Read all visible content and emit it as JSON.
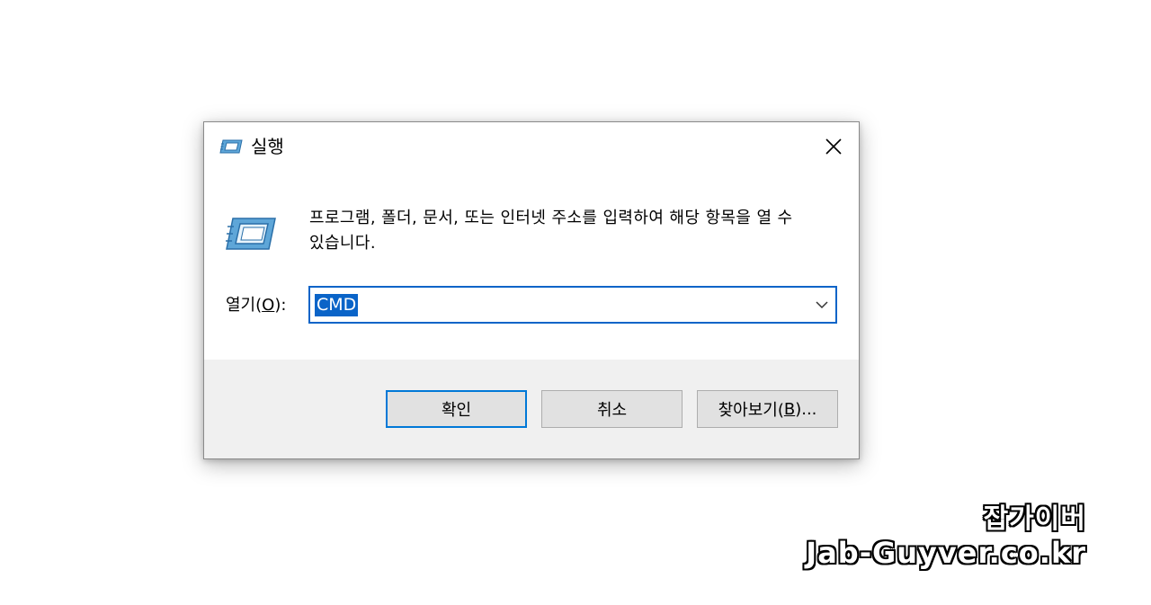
{
  "dialog": {
    "title": "실행",
    "close_icon": "close-icon",
    "description": "프로그램, 폴더, 문서, 또는 인터넷 주소를 입력하여 해당 항목을 열 수 있습니다.",
    "open_label_prefix": "열기(",
    "open_label_accel": "O",
    "open_label_suffix": "):",
    "open_value": "CMD",
    "buttons": {
      "ok": "확인",
      "cancel": "취소",
      "browse_prefix": "찾아보기(",
      "browse_accel": "B",
      "browse_suffix": ")..."
    },
    "accent_color": "#0a64c8"
  },
  "watermark": {
    "line1": "잡가이버",
    "line2": "Jab-Guyver.co.kr"
  }
}
